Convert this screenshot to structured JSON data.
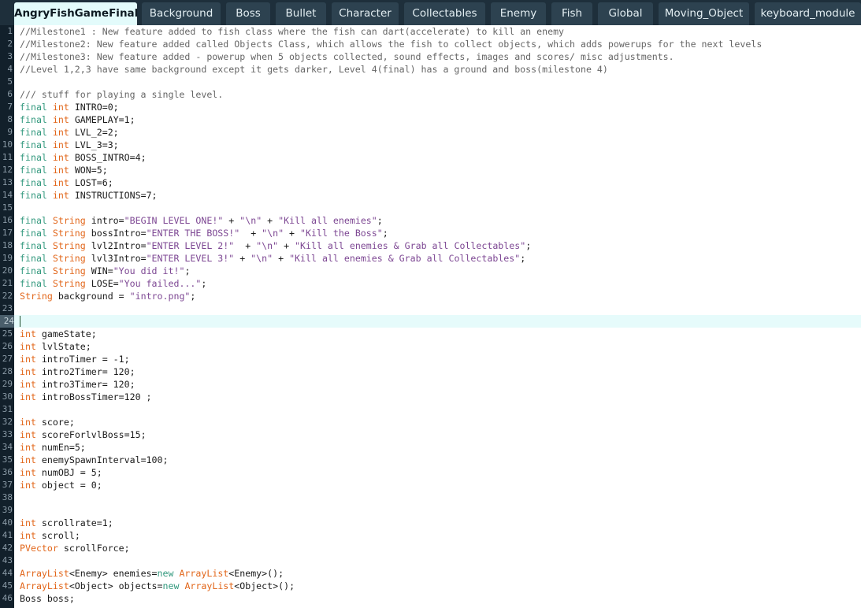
{
  "colors": {
    "tabbar_bg": "#1e2f3b",
    "tab_bg": "#2d4250",
    "tab_active_bg": "#e3fbfb",
    "gutter_bg": "#12202b",
    "current_line_bg": "#e6fbfb",
    "comment": "#666666",
    "keyword": "#33997e",
    "type": "#e2661a",
    "string": "#7d4793"
  },
  "tabs": [
    {
      "label": "AngryFishGameFinal",
      "active": true
    },
    {
      "label": "Background",
      "active": false
    },
    {
      "label": "Boss",
      "active": false
    },
    {
      "label": "Bullet",
      "active": false
    },
    {
      "label": "Character",
      "active": false
    },
    {
      "label": "Collectables",
      "active": false
    },
    {
      "label": "Enemy",
      "active": false
    },
    {
      "label": "Fish",
      "active": false
    },
    {
      "label": "Global",
      "active": false
    },
    {
      "label": "Moving_Object",
      "active": false
    },
    {
      "label": "keyboard_module",
      "active": false
    }
  ],
  "editor": {
    "current_line": 24,
    "lines": [
      [
        [
          "c",
          "//Milestone1 : New feature added to fish class where the fish can dart(accelerate) to kill an enemy"
        ]
      ],
      [
        [
          "c",
          "//Milestone2: New feature added called Objects Class, which allows the fish to collect objects, which adds powerups for the next levels"
        ]
      ],
      [
        [
          "c",
          "//Milestone3: New feature added - powerup when 5 objects collected, sound effects, images and scores/ misc adjustments."
        ]
      ],
      [
        [
          "c",
          "//Level 1,2,3 have same background except it gets darker, Level 4(final) has a ground and boss(milestone 4)"
        ]
      ],
      [],
      [
        [
          "c",
          "/// stuff for playing a single level."
        ]
      ],
      [
        [
          "k",
          "final"
        ],
        [
          "p",
          " "
        ],
        [
          "t",
          "int"
        ],
        [
          "p",
          " INTRO=0;"
        ]
      ],
      [
        [
          "k",
          "final"
        ],
        [
          "p",
          " "
        ],
        [
          "t",
          "int"
        ],
        [
          "p",
          " GAMEPLAY=1;"
        ]
      ],
      [
        [
          "k",
          "final"
        ],
        [
          "p",
          " "
        ],
        [
          "t",
          "int"
        ],
        [
          "p",
          " LVL_2=2;"
        ]
      ],
      [
        [
          "k",
          "final"
        ],
        [
          "p",
          " "
        ],
        [
          "t",
          "int"
        ],
        [
          "p",
          " LVL_3=3;"
        ]
      ],
      [
        [
          "k",
          "final"
        ],
        [
          "p",
          " "
        ],
        [
          "t",
          "int"
        ],
        [
          "p",
          " BOSS_INTRO=4;"
        ]
      ],
      [
        [
          "k",
          "final"
        ],
        [
          "p",
          " "
        ],
        [
          "t",
          "int"
        ],
        [
          "p",
          " WON=5;"
        ]
      ],
      [
        [
          "k",
          "final"
        ],
        [
          "p",
          " "
        ],
        [
          "t",
          "int"
        ],
        [
          "p",
          " LOST=6;"
        ]
      ],
      [
        [
          "k",
          "final"
        ],
        [
          "p",
          " "
        ],
        [
          "t",
          "int"
        ],
        [
          "p",
          " INSTRUCTIONS=7;"
        ]
      ],
      [],
      [
        [
          "k",
          "final"
        ],
        [
          "p",
          " "
        ],
        [
          "t",
          "String"
        ],
        [
          "p",
          " intro="
        ],
        [
          "s",
          "\"BEGIN LEVEL ONE!\""
        ],
        [
          "p",
          " + "
        ],
        [
          "s",
          "\"\\n\""
        ],
        [
          "p",
          " + "
        ],
        [
          "s",
          "\"Kill all enemies\""
        ],
        [
          "p",
          ";"
        ]
      ],
      [
        [
          "k",
          "final"
        ],
        [
          "p",
          " "
        ],
        [
          "t",
          "String"
        ],
        [
          "p",
          " bossIntro="
        ],
        [
          "s",
          "\"ENTER THE BOSS!\""
        ],
        [
          "p",
          "  + "
        ],
        [
          "s",
          "\"\\n\""
        ],
        [
          "p",
          " + "
        ],
        [
          "s",
          "\"Kill the Boss\""
        ],
        [
          "p",
          ";"
        ]
      ],
      [
        [
          "k",
          "final"
        ],
        [
          "p",
          " "
        ],
        [
          "t",
          "String"
        ],
        [
          "p",
          " lvl2Intro="
        ],
        [
          "s",
          "\"ENTER LEVEL 2!\""
        ],
        [
          "p",
          "  + "
        ],
        [
          "s",
          "\"\\n\""
        ],
        [
          "p",
          " + "
        ],
        [
          "s",
          "\"Kill all enemies & Grab all Collectables\""
        ],
        [
          "p",
          ";"
        ]
      ],
      [
        [
          "k",
          "final"
        ],
        [
          "p",
          " "
        ],
        [
          "t",
          "String"
        ],
        [
          "p",
          " lvl3Intro="
        ],
        [
          "s",
          "\"ENTER LEVEL 3!\""
        ],
        [
          "p",
          " + "
        ],
        [
          "s",
          "\"\\n\""
        ],
        [
          "p",
          " + "
        ],
        [
          "s",
          "\"Kill all enemies & Grab all Collectables\""
        ],
        [
          "p",
          ";"
        ]
      ],
      [
        [
          "k",
          "final"
        ],
        [
          "p",
          " "
        ],
        [
          "t",
          "String"
        ],
        [
          "p",
          " WIN="
        ],
        [
          "s",
          "\"You did it!\""
        ],
        [
          "p",
          ";"
        ]
      ],
      [
        [
          "k",
          "final"
        ],
        [
          "p",
          " "
        ],
        [
          "t",
          "String"
        ],
        [
          "p",
          " LOSE="
        ],
        [
          "s",
          "\"You failed...\""
        ],
        [
          "p",
          ";"
        ]
      ],
      [
        [
          "t",
          "String"
        ],
        [
          "p",
          " background = "
        ],
        [
          "s",
          "\"intro.png\""
        ],
        [
          "p",
          ";"
        ]
      ],
      [],
      [],
      [
        [
          "t",
          "int"
        ],
        [
          "p",
          " gameState;"
        ]
      ],
      [
        [
          "t",
          "int"
        ],
        [
          "p",
          " lvlState;"
        ]
      ],
      [
        [
          "t",
          "int"
        ],
        [
          "p",
          " introTimer = -1;"
        ]
      ],
      [
        [
          "t",
          "int"
        ],
        [
          "p",
          " intro2Timer= 120;"
        ]
      ],
      [
        [
          "t",
          "int"
        ],
        [
          "p",
          " intro3Timer= 120;"
        ]
      ],
      [
        [
          "t",
          "int"
        ],
        [
          "p",
          " introBossTimer=120 ;"
        ]
      ],
      [],
      [
        [
          "t",
          "int"
        ],
        [
          "p",
          " score;"
        ]
      ],
      [
        [
          "t",
          "int"
        ],
        [
          "p",
          " scoreForlvlBoss=15;"
        ]
      ],
      [
        [
          "t",
          "int"
        ],
        [
          "p",
          " numEn=5;"
        ]
      ],
      [
        [
          "t",
          "int"
        ],
        [
          "p",
          " enemySpawnInterval=100;"
        ]
      ],
      [
        [
          "t",
          "int"
        ],
        [
          "p",
          " numOBJ = 5;"
        ]
      ],
      [
        [
          "t",
          "int"
        ],
        [
          "p",
          " object = 0;"
        ]
      ],
      [],
      [],
      [
        [
          "t",
          "int"
        ],
        [
          "p",
          " scrollrate=1;"
        ]
      ],
      [
        [
          "t",
          "int"
        ],
        [
          "p",
          " scroll;"
        ]
      ],
      [
        [
          "t",
          "PVector"
        ],
        [
          "p",
          " scrollForce;"
        ]
      ],
      [],
      [
        [
          "t",
          "ArrayList"
        ],
        [
          "p",
          "<Enemy> enemies="
        ],
        [
          "k",
          "new"
        ],
        [
          "p",
          " "
        ],
        [
          "t",
          "ArrayList"
        ],
        [
          "p",
          "<Enemy>();"
        ]
      ],
      [
        [
          "t",
          "ArrayList"
        ],
        [
          "p",
          "<Object> objects="
        ],
        [
          "k",
          "new"
        ],
        [
          "p",
          " "
        ],
        [
          "t",
          "ArrayList"
        ],
        [
          "p",
          "<Object>();"
        ]
      ],
      [
        [
          "p",
          "Boss boss;"
        ]
      ]
    ]
  }
}
